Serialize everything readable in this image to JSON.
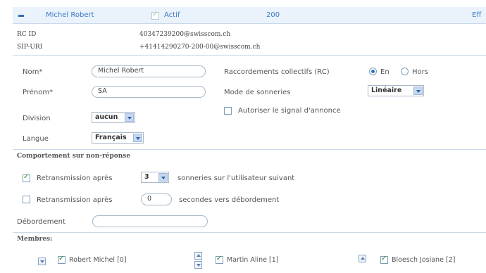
{
  "header": {
    "name": "Michel Robert",
    "status": "Actif",
    "extension": "200",
    "action": "Eff"
  },
  "info": {
    "rcid_label": "RC ID",
    "rcid_value": "40347239200@swisscom.ch",
    "sip_label": "SIP-URI",
    "sip_value": "+41414290270-200-00@swisscom.ch"
  },
  "form": {
    "nom_label": "Nom*",
    "nom_value": "Michel Robert",
    "prenom_label": "Prénom*",
    "prenom_value": "SA",
    "division_label": "Division",
    "division_value": "aucun",
    "langue_label": "Langue",
    "langue_value": "Français",
    "raccordements_label": "Raccordements collectifs (RC)",
    "radio_en": "En",
    "radio_hors": "Hors",
    "mode_label": "Mode de sonneries",
    "mode_value": "Linéaire",
    "autoriser_label": "Autoriser le signal d'annonce"
  },
  "behavior": {
    "title": "Comportement sur non-réponse",
    "retrans1_label": "Retransmission après",
    "retrans1_value": "3",
    "retrans1_suffix": "sonneries sur l'utilisateur suivant",
    "retrans2_label": "Retransmission après",
    "retrans2_value": "0",
    "retrans2_suffix": "secondes vers débordement",
    "debordement_label": "Débordement",
    "debordement_value": ""
  },
  "members": {
    "title": "Membres:",
    "items": [
      {
        "name": "Robert Michel [0]"
      },
      {
        "name": "Martin Aline [1]"
      },
      {
        "name": "Bloesch Josiane [2]"
      }
    ]
  },
  "colors": {
    "accent": "#3b7bc8",
    "header_bg": "#eaf2fb",
    "check": "#2a8a2a"
  }
}
